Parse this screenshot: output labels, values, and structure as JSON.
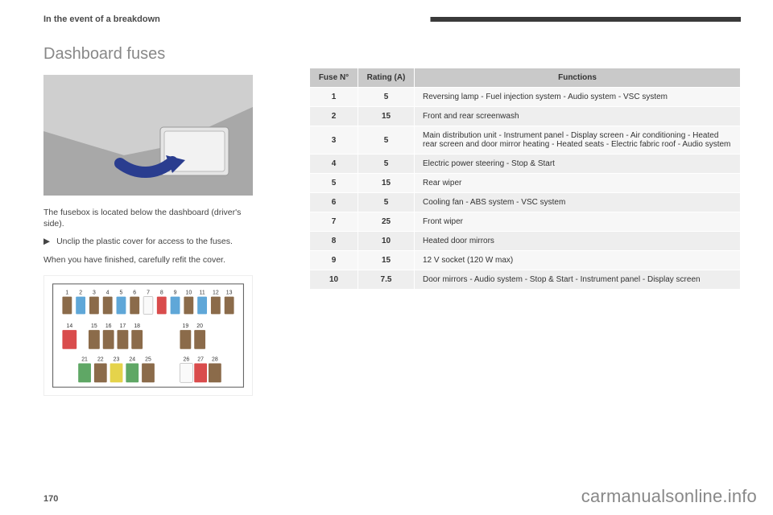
{
  "header": {
    "chapter": "In the event of a breakdown"
  },
  "section": {
    "title": "Dashboard fuses"
  },
  "intro": {
    "p1": "The fusebox is located below the dashboard (driver's side).",
    "bullet_marker": "▶",
    "bullet": "Unclip the plastic cover for access to the fuses.",
    "p2": "When you have finished, carefully refit the cover."
  },
  "table": {
    "headers": {
      "fuse": "Fuse N°",
      "rating": "Rating (A)",
      "functions": "Functions"
    },
    "rows": [
      {
        "n": "1",
        "a": "5",
        "f": "Reversing lamp - Fuel injection system - Audio system - VSC system"
      },
      {
        "n": "2",
        "a": "15",
        "f": "Front and rear screenwash"
      },
      {
        "n": "3",
        "a": "5",
        "f": "Main distribution unit - Instrument panel - Display screen - Air conditioning - Heated rear screen and door mirror heating - Heated seats - Electric fabric roof - Audio system"
      },
      {
        "n": "4",
        "a": "5",
        "f": "Electric power steering - Stop & Start"
      },
      {
        "n": "5",
        "a": "15",
        "f": "Rear wiper"
      },
      {
        "n": "6",
        "a": "5",
        "f": "Cooling fan - ABS system - VSC system"
      },
      {
        "n": "7",
        "a": "25",
        "f": "Front wiper"
      },
      {
        "n": "8",
        "a": "10",
        "f": "Heated door mirrors"
      },
      {
        "n": "9",
        "a": "15",
        "f": "12 V socket (120 W max)"
      },
      {
        "n": "10",
        "a": "7.5",
        "f": "Door mirrors - Audio system - Stop & Start - Instrument panel - Display screen"
      }
    ]
  },
  "diagram": {
    "row1": [
      {
        "n": "1",
        "c": "brown"
      },
      {
        "n": "2",
        "c": "blue"
      },
      {
        "n": "3",
        "c": "brown"
      },
      {
        "n": "4",
        "c": "brown"
      },
      {
        "n": "5",
        "c": "blue"
      },
      {
        "n": "6",
        "c": "brown"
      },
      {
        "n": "7",
        "c": "white"
      },
      {
        "n": "8",
        "c": "red"
      },
      {
        "n": "9",
        "c": "blue"
      },
      {
        "n": "10",
        "c": "brown"
      },
      {
        "n": "11",
        "c": "blue"
      },
      {
        "n": "12",
        "c": "brown"
      },
      {
        "n": "13",
        "c": "brown"
      }
    ],
    "row2": [
      {
        "n": "14",
        "c": "red"
      },
      {
        "n": "15",
        "c": "brown"
      },
      {
        "n": "16",
        "c": "brown"
      },
      {
        "n": "17",
        "c": "brown"
      },
      {
        "n": "18",
        "c": "brown"
      },
      {
        "n": "19",
        "c": "brown"
      },
      {
        "n": "20",
        "c": "brown"
      }
    ],
    "row2_gaps": [
      0,
      2,
      2,
      2,
      2,
      5,
      2
    ],
    "row3": [
      {
        "n": "21",
        "c": "green"
      },
      {
        "n": "22",
        "c": "brown"
      },
      {
        "n": "23",
        "c": "yellow"
      },
      {
        "n": "24",
        "c": "green"
      },
      {
        "n": "25",
        "c": "brown"
      },
      {
        "n": "26",
        "c": "white"
      },
      {
        "n": "27",
        "c": "red"
      },
      {
        "n": "28",
        "c": "brown"
      }
    ],
    "row3_gaps": [
      0,
      2,
      2,
      2,
      2,
      5,
      2,
      2
    ]
  },
  "page_number": "170",
  "watermark": "carmanualsonline.info"
}
